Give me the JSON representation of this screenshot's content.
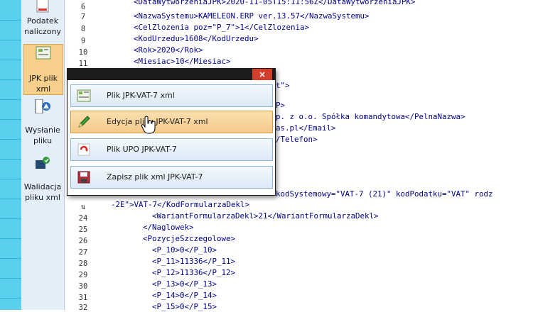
{
  "toolbar": {
    "items": [
      {
        "label": "Podatek naliczony",
        "selected": false
      },
      {
        "label": "JPK plik xml",
        "selected": true
      },
      {
        "label": "Wysłanie pliku",
        "selected": false
      },
      {
        "label": "Walidacja pliku xml",
        "selected": false
      }
    ]
  },
  "popup": {
    "close_glyph": "×",
    "items": [
      {
        "label": "Plik JPK-VAT-7 xml",
        "icon": "xml-file-icon"
      },
      {
        "label": "Edycja pliku JPK-VAT-7 xml",
        "icon": "pencil-edit-icon"
      },
      {
        "label": "Plik UPO JPK-VAT-7",
        "icon": "upo-file-icon"
      },
      {
        "label": "Zapisz plik xml JPK-VAT-7",
        "icon": "save-disk-icon"
      }
    ]
  },
  "editor": {
    "lines": [
      {
        "n": "6",
        "text": "<DataWytworzeniaJPK>2020-11-05T15:11:56Z</DataWytworzeniaJPK>"
      },
      {
        "n": "7",
        "text": "<NazwaSystemu>KAMELEON.ERP ver.13.57</NazwaSystemu>"
      },
      {
        "n": "8",
        "text": "<CelZlozenia poz=\"P_7\">1</CelZlozenia>"
      },
      {
        "n": "9",
        "text": "<KodUrzedu>1608</KodUrzedu>"
      },
      {
        "n": "10",
        "text": "<Rok>2020</Rok>"
      },
      {
        "n": "11",
        "text": "<Miesiac>10</Miesiac>"
      },
      {
        "n": "",
        "text": "t\">"
      },
      {
        "n": "",
        "text": "P>"
      },
      {
        "n": "",
        "text": "p. z o.o. Spółka komandytowa</PelnaNazwa>"
      },
      {
        "n": "",
        "text": "as.pl</Email>"
      },
      {
        "n": "",
        "text": "/Telefon>"
      },
      {
        "n": "",
        "text": "kodSystemowy=\"VAT-7 (21)\" kodPodatku=\"VAT\" rodz"
      },
      {
        "n": "⇅",
        "text": "-2E\">VAT-7</KodFormularzaDekl>"
      },
      {
        "n": "24",
        "text": "    <WariantFormularzaDekl>21</WariantFormularzaDekl>"
      },
      {
        "n": "25",
        "text": "  </Naglowek>"
      },
      {
        "n": "26",
        "text": "  <PozycjeSzczegolowe>"
      },
      {
        "n": "27",
        "text": "    <P_10>0</P_10>"
      },
      {
        "n": "28",
        "text": "    <P_11>11336</P_11>"
      },
      {
        "n": "29",
        "text": "    <P_12>11336</P_12>"
      },
      {
        "n": "30",
        "text": "    <P_13>0</P_13>"
      },
      {
        "n": "31",
        "text": "    <P_14>0</P_14>"
      },
      {
        "n": "32",
        "text": "    <P_15>0</P_15>"
      }
    ]
  }
}
